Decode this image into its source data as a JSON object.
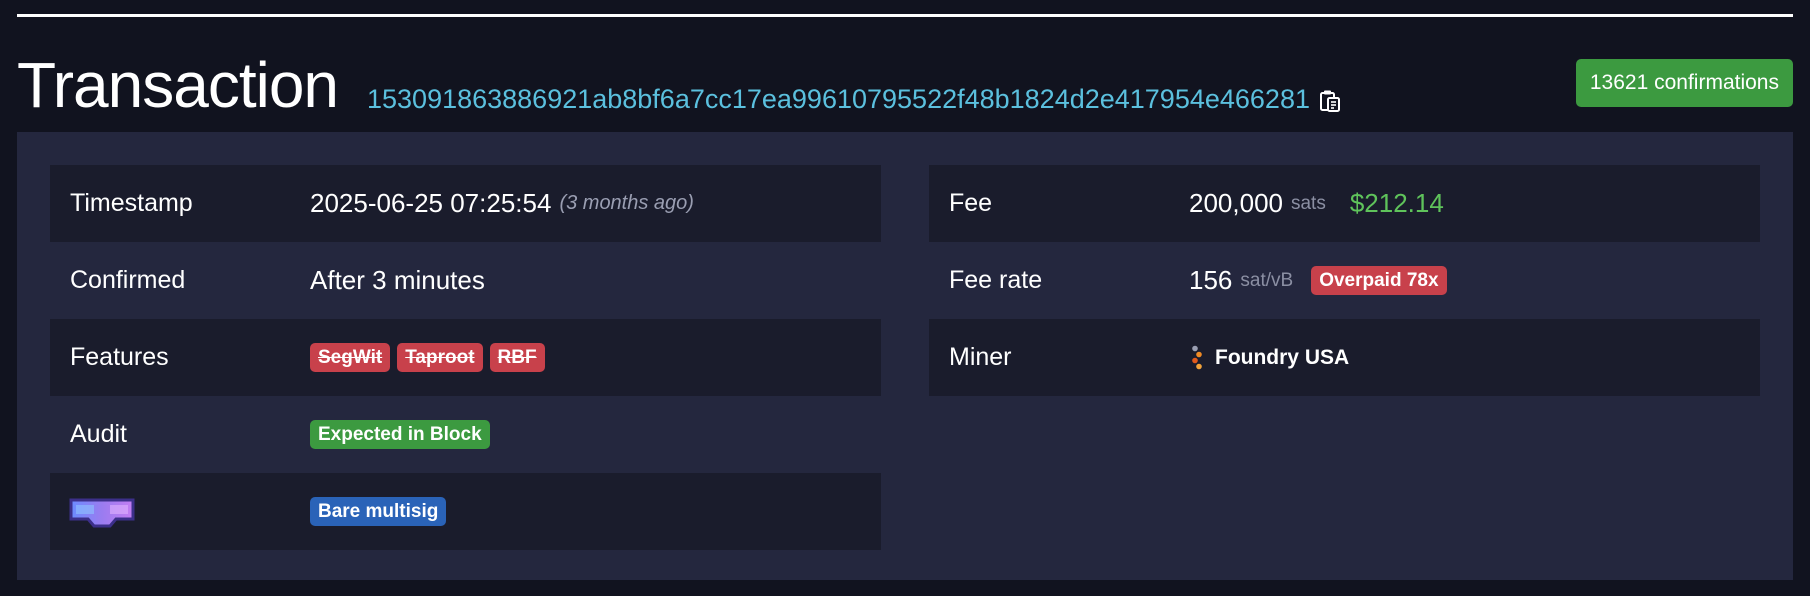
{
  "page": {
    "title": "Transaction",
    "txid": "153091863886921ab8bf6a7cc17ea99610795522f48b1824d2e417954e466281",
    "confirmations": "13621 confirmations",
    "copy_icon": "clipboard-icon"
  },
  "details_left": {
    "timestamp": {
      "label": "Timestamp",
      "value": "2025-06-25 07:25:54",
      "relative": "(3 months ago)"
    },
    "confirmed": {
      "label": "Confirmed",
      "value": "After 3 minutes"
    },
    "features": {
      "label": "Features",
      "badges": [
        "SegWit",
        "Taproot",
        "RBF"
      ]
    },
    "audit": {
      "label": "Audit",
      "badge": "Expected in Block"
    },
    "flag": {
      "icon": "glasses-icon",
      "badge": "Bare multisig"
    }
  },
  "details_right": {
    "fee": {
      "label": "Fee",
      "value": "200,000",
      "unit": "sats",
      "fiat": "$212.14"
    },
    "fee_rate": {
      "label": "Fee rate",
      "value": "156",
      "unit": "sat/vB",
      "badge": "Overpaid 78x"
    },
    "miner": {
      "label": "Miner",
      "name": "Foundry USA",
      "icon": "foundry-logo-icon"
    }
  },
  "colors": {
    "background": "#11131f",
    "panel": "#24273e",
    "row_dark": "#1a1c2c",
    "link": "#5bc0de",
    "success": "#3c9a40",
    "danger": "#c8414b",
    "info": "#2a63b8",
    "fiat": "#5fc35b"
  }
}
